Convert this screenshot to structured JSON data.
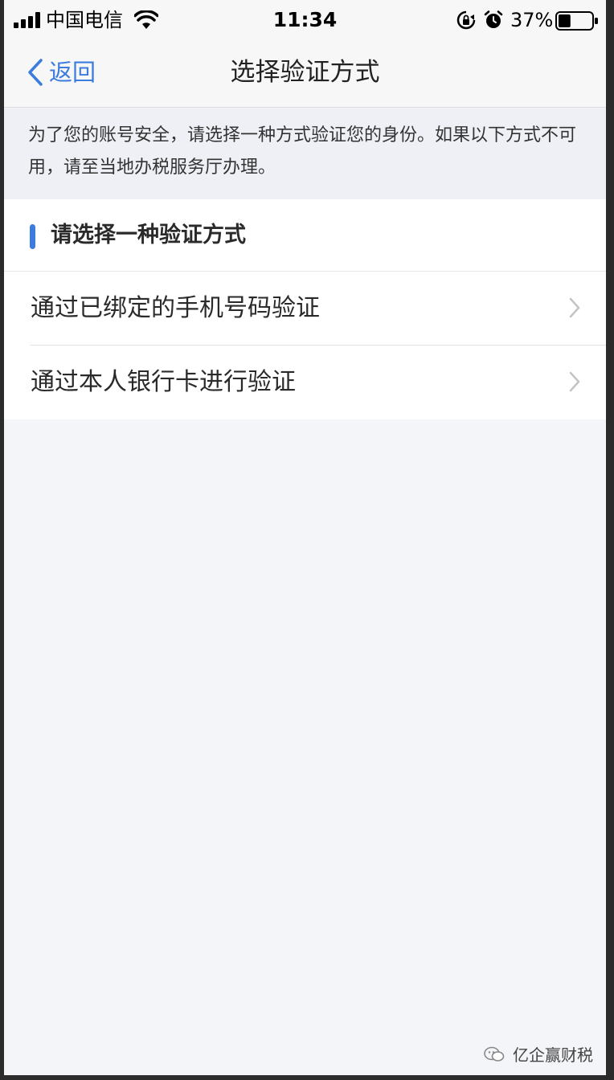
{
  "status_bar": {
    "carrier": "中国电信",
    "time": "11:34",
    "battery_percent": "37%",
    "battery_level": 0.37
  },
  "nav": {
    "back_label": "返回",
    "title": "选择验证方式"
  },
  "notice": {
    "text": "为了您的账号安全，请选择一种方式验证您的身份。如果以下方式不可用，请至当地办税服务厅办理。"
  },
  "list": {
    "section_title": "请选择一种验证方式",
    "items": [
      {
        "label": "通过已绑定的手机号码验证"
      },
      {
        "label": "通过本人银行卡进行验证"
      }
    ]
  },
  "watermark": {
    "text": "亿企赢财税"
  },
  "colors": {
    "accent": "#3c7cde",
    "background": "#f4f5f9"
  },
  "icons": {
    "back": "chevron-left-icon",
    "row": "chevron-right-icon",
    "signal": "signal-icon",
    "wifi": "wifi-icon",
    "rotation_lock": "rotation-lock-icon",
    "alarm": "alarm-icon",
    "battery": "battery-icon"
  }
}
